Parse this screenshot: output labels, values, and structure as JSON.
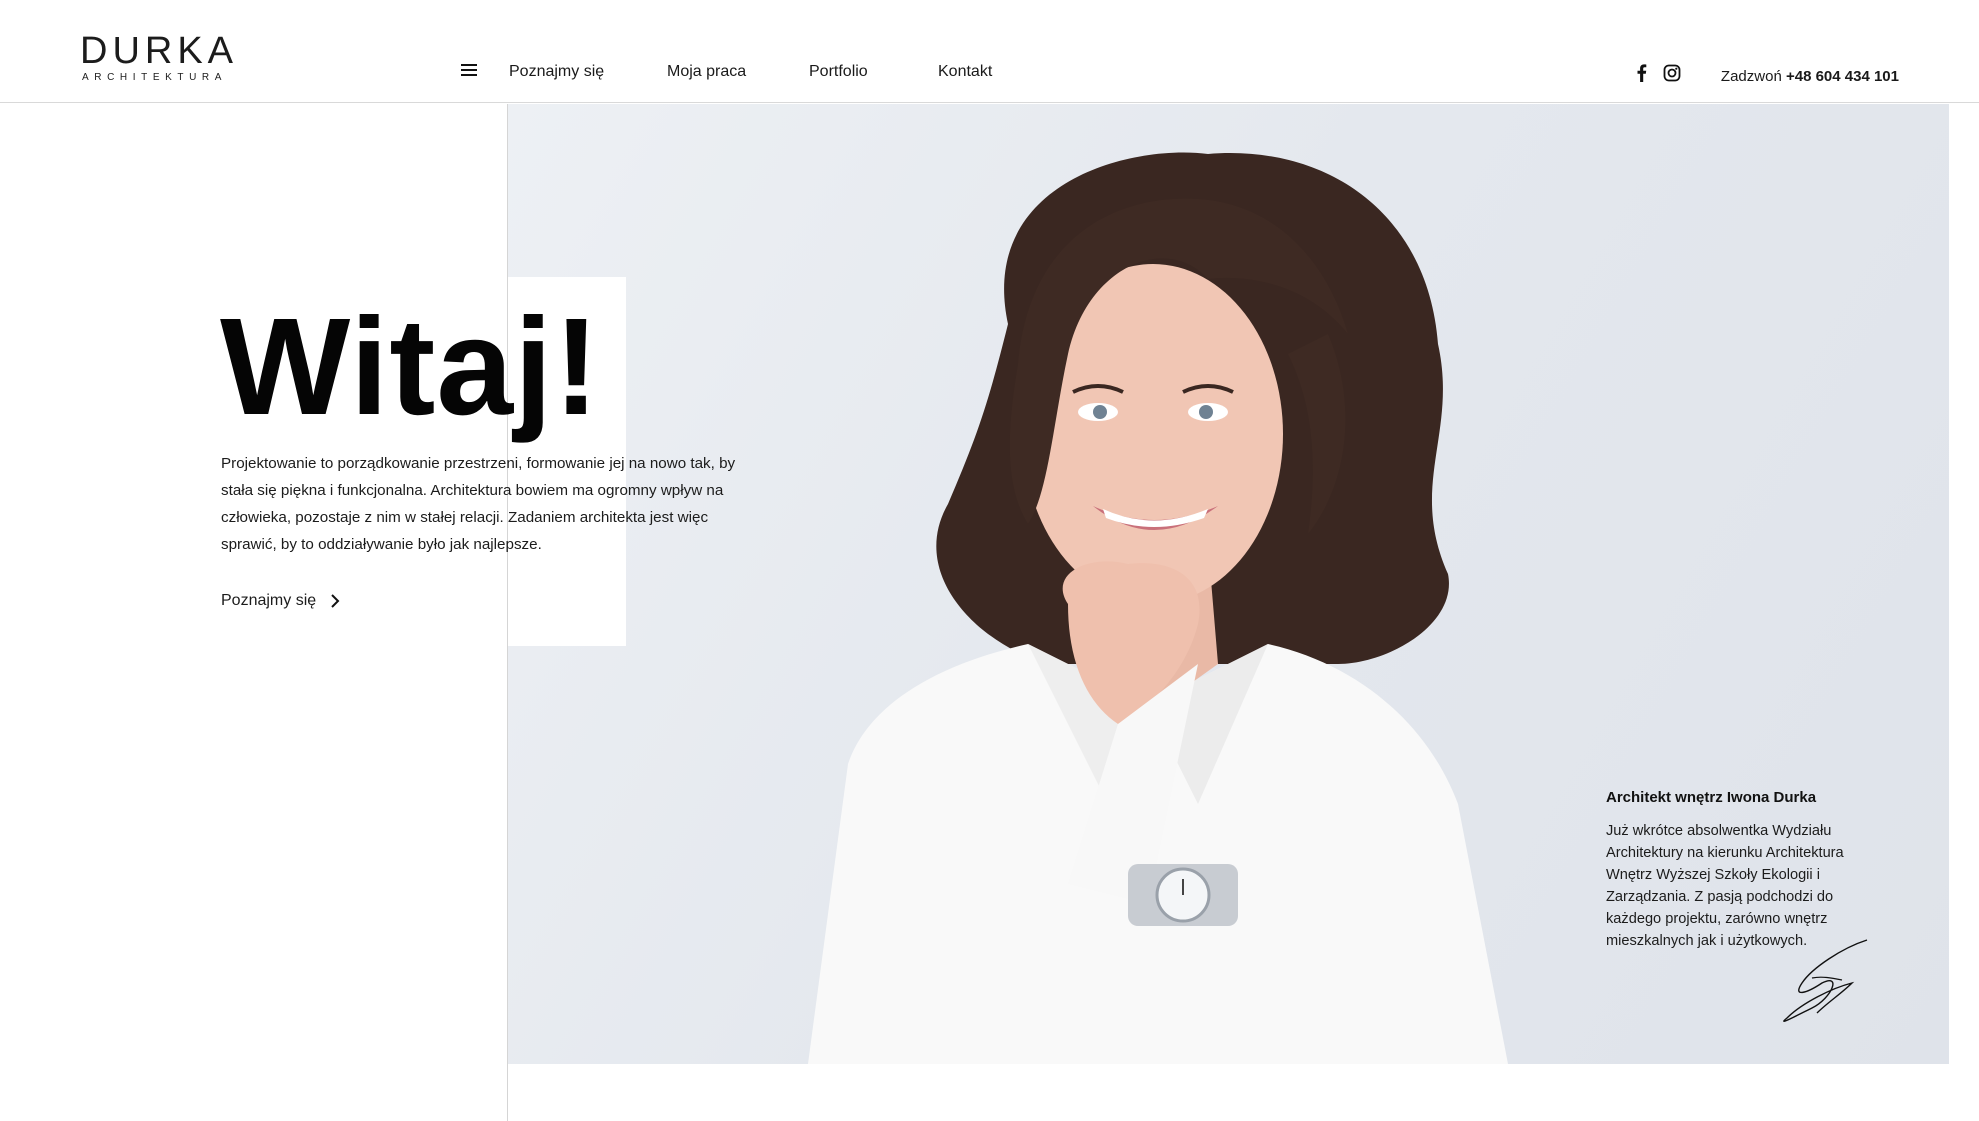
{
  "header": {
    "logo_text": "DURKA",
    "logo_subtitle": "ARCHITEKTURA",
    "nav": [
      "Poznajmy się",
      "Moja praca",
      "Portfolio",
      "Kontakt"
    ],
    "social_icons": [
      "facebook-icon",
      "instagram-icon"
    ],
    "phone_label": "Zadzwoń",
    "phone_number": "+48 604 434 101"
  },
  "hero": {
    "title": "Witaj!",
    "intro": "Projektowanie to porządkowanie przestrzeni, formowanie jej na nowo tak, by stała się piękna i funkcjonalna. Architektura bowiem ma ogromny wpływ na człowieka, pozostaje z nim w stałej relacji. Zadaniem architekta jest więc sprawić, by to oddziaływanie było jak najlepsze.",
    "more_link": "Poznajmy się"
  },
  "bio": {
    "title": "Architekt wnętrz Iwona Durka",
    "text": "Już wkrótce absolwentka Wydziału Architektury na kierunku Architektura Wnętrz Wyższej Szkoły Ekologii i Zarządzania. Z pasją podchodzi do każdego projektu, zarówno wnętrz mieszkalnych jak i użytkowych."
  },
  "colors": {
    "text": "#111111",
    "photo_bg": "#e6e9ee",
    "divider": "#d9d9d9"
  }
}
